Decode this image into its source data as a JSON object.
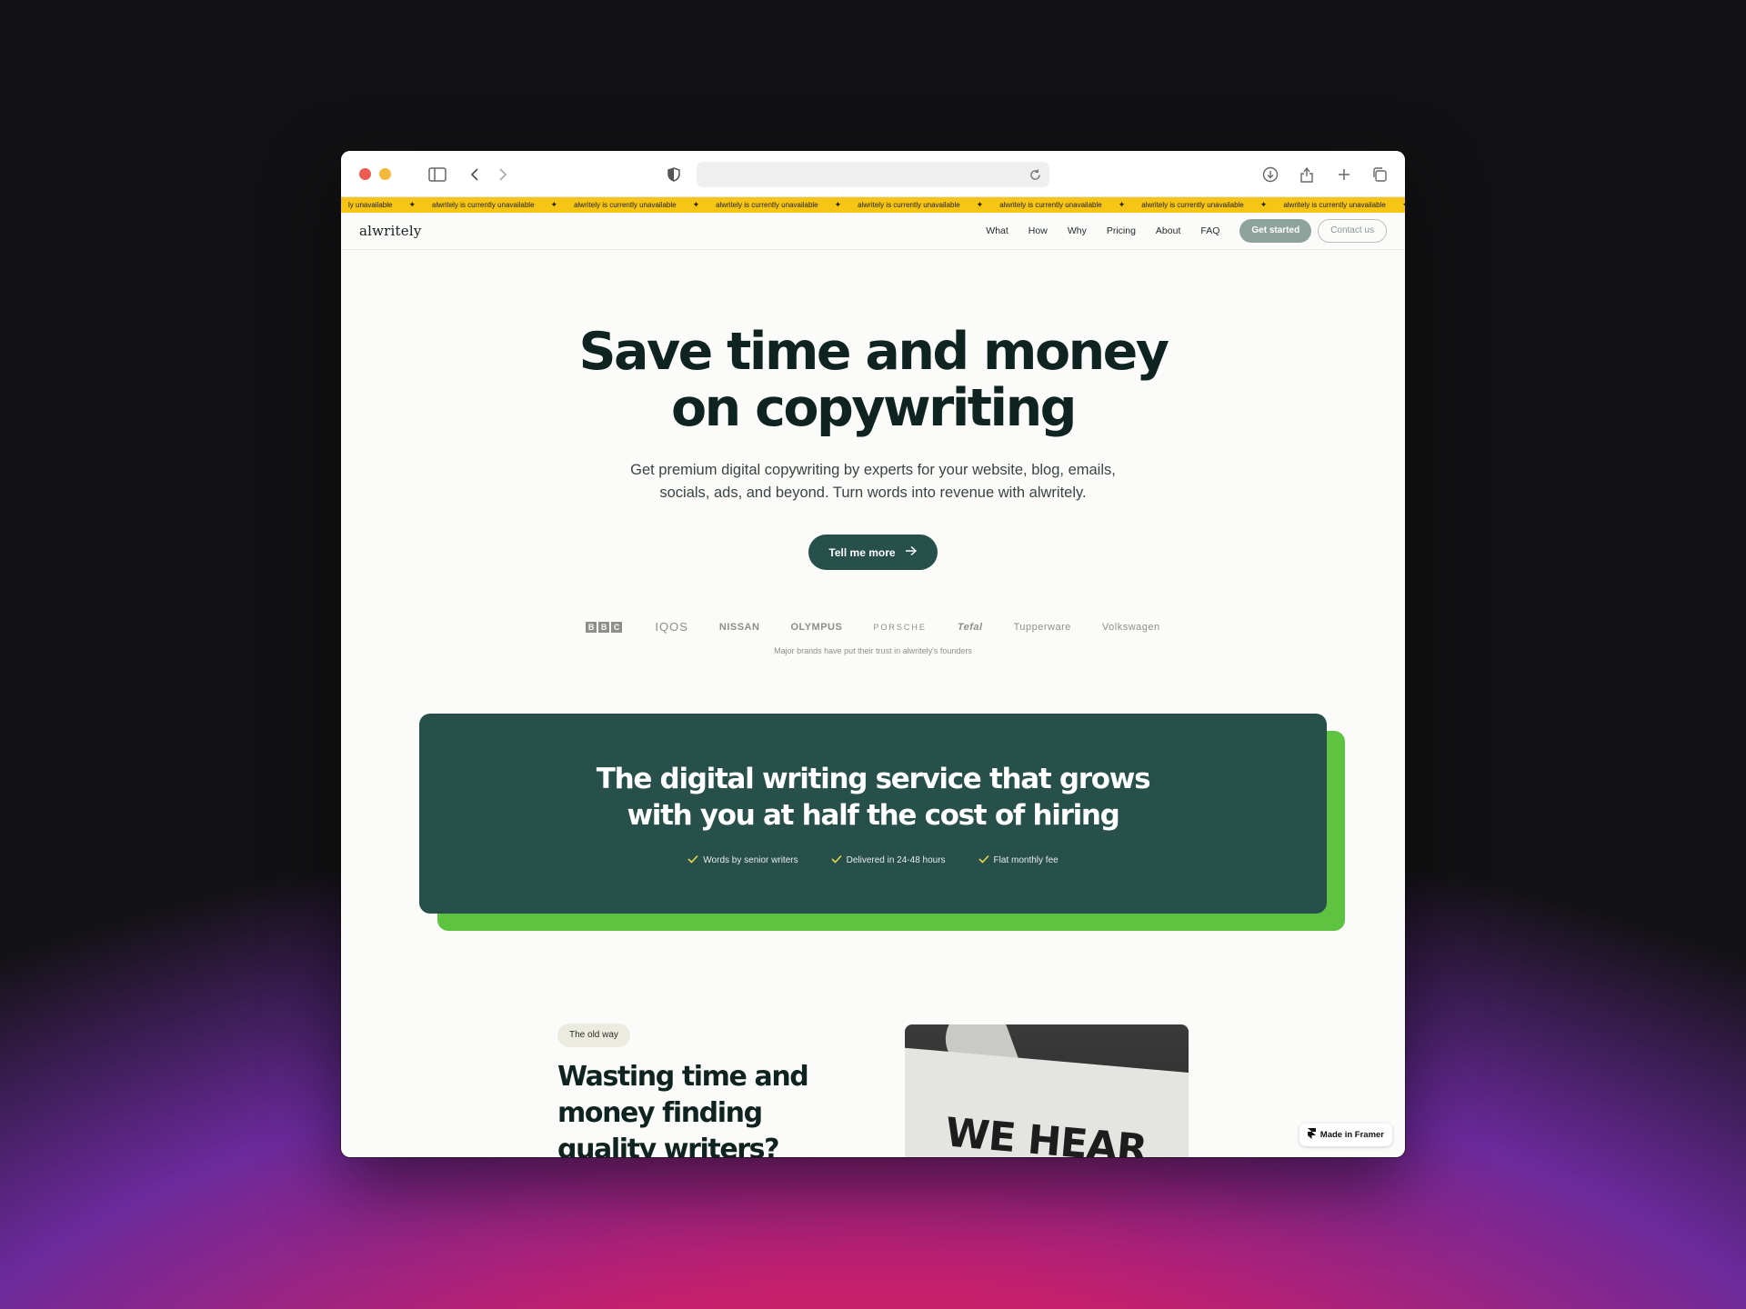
{
  "ticker": {
    "items": [
      "ly unavailable",
      "alwritely is currently unavailable",
      "alwritely is currently unavailable",
      "alwritely is currently unavailable",
      "alwritely is currently unavailable",
      "alwritely is currently unavailable",
      "alwritely is currently unavailable",
      "alwritely is currently unavailable",
      "alwritely is curre"
    ],
    "separator": "✦"
  },
  "nav": {
    "logo": "alwritely",
    "links": [
      "What",
      "How",
      "Why",
      "Pricing",
      "About",
      "FAQ"
    ],
    "get_started": "Get started",
    "contact": "Contact us"
  },
  "hero": {
    "title_line1": "Save time and money",
    "title_line2": "on copywriting",
    "subtitle": "Get premium digital copywriting by experts for your website, blog, emails, socials, ads, and beyond. Turn words into revenue with alwritely.",
    "cta": "Tell me more",
    "brands": [
      "BBC",
      "IQOS",
      "NISSAN",
      "OLYMPUS",
      "PORSCHE",
      "Tefal",
      "Tupperware",
      "Volkswagen"
    ],
    "brands_caption": "Major brands have put their trust in alwritely's founders"
  },
  "value": {
    "title_line1": "The digital writing service that grows",
    "title_line2": "with you at half the cost of hiring",
    "features": [
      "Words by senior writers",
      "Delivered in 24-48 hours",
      "Flat monthly fee"
    ]
  },
  "oldway": {
    "pill": "The old way",
    "title": "Wasting time and money finding quality writers?",
    "image_text": "WE HEAR YOU"
  },
  "badge": {
    "label": "Made in Framer"
  },
  "colors": {
    "accent_green": "#27504a",
    "ticker_yellow": "#f6c516",
    "check_yellow": "#e4d84a"
  }
}
